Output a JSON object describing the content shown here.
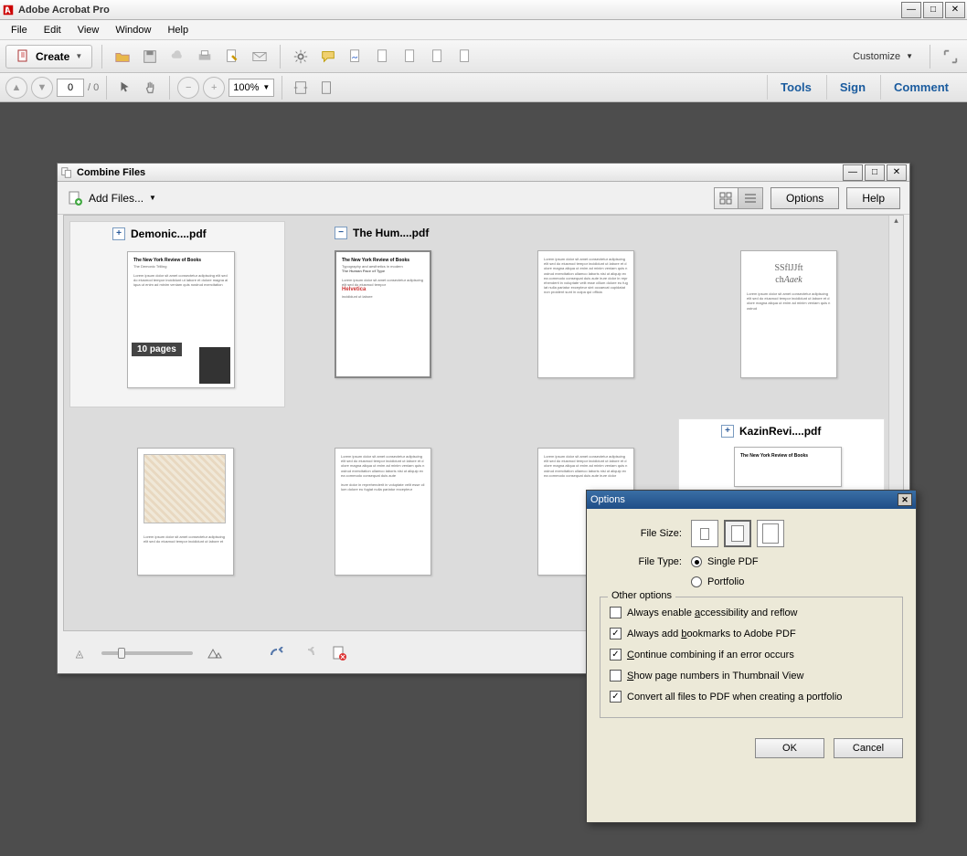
{
  "app": {
    "title": "Adobe Acrobat Pro"
  },
  "menu": [
    "File",
    "Edit",
    "View",
    "Window",
    "Help"
  ],
  "toolbar": {
    "create": "Create",
    "customize": "Customize"
  },
  "nav": {
    "page": "0",
    "pagecount": "/ 0",
    "zoom": "100%"
  },
  "rightpanel": {
    "tools": "Tools",
    "sign": "Sign",
    "comment": "Comment"
  },
  "combine": {
    "title": "Combine Files",
    "addfiles": "Add Files...",
    "options": "Options",
    "help": "Help",
    "files": [
      {
        "name": "Demonic....pdf",
        "badge": "10 pages"
      },
      {
        "name": "The Hum....pdf"
      },
      {
        "name": "KazinRevi....pdf"
      }
    ]
  },
  "optdlg": {
    "title": "Options",
    "filesize": "File Size:",
    "filetype": "File Type:",
    "type_single": "Single PDF",
    "type_portfolio": "Portfolio",
    "group": "Other options",
    "opts": {
      "a": {
        "pre": "Always enable ",
        "u": "a",
        "post": "ccessibility and reflow"
      },
      "b": {
        "pre": "Always add ",
        "u": "b",
        "post": "ookmarks to Adobe PDF"
      },
      "c": {
        "u": "C",
        "post": "ontinue combining if an error occurs"
      },
      "d": {
        "u": "S",
        "post": "how page numbers in Thumbnail View"
      },
      "e": {
        "pre": "Convert all files to PDF when creating a portfolio"
      }
    },
    "ok": "OK",
    "cancel": "Cancel"
  }
}
